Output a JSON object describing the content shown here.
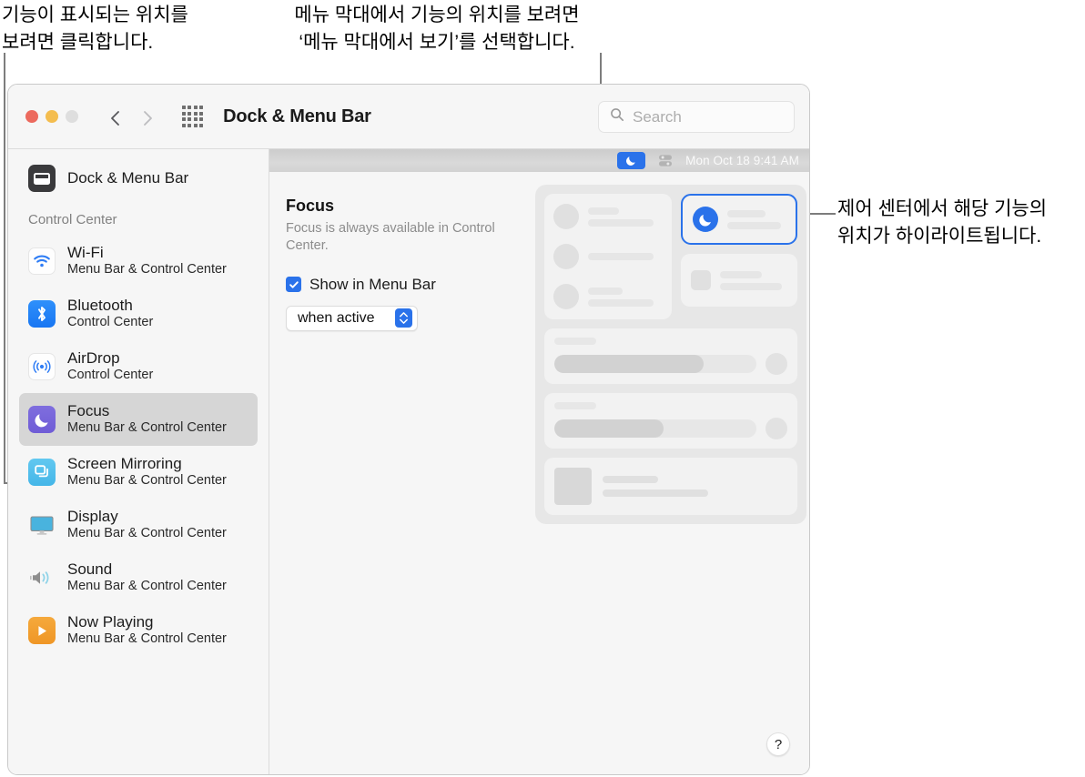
{
  "annotations": {
    "left": "기능이 표시되는 위치를\n보려면 클릭합니다.",
    "top": "메뉴 막대에서 기능의 위치를 보려면\n‘메뉴 막대에서 보기’를 선택합니다.",
    "right": "제어 센터에서 해당 기능의\n위치가 하이라이트됩니다."
  },
  "window": {
    "title": "Dock & Menu Bar",
    "traffic_lights": [
      "close",
      "minimize",
      "zoom"
    ],
    "nav": {
      "back": "back-arrow",
      "forward": "forward-arrow",
      "grid": "show-all-grid"
    },
    "search": {
      "placeholder": "Search",
      "icon": "search-icon"
    }
  },
  "sidebar": {
    "top_item": {
      "label": "Dock & Menu Bar",
      "icon": "dock-icon"
    },
    "group_label": "Control Center",
    "items": [
      {
        "label": "Wi-Fi",
        "sublabel": "Menu Bar & Control Center",
        "icon": "wifi-icon",
        "selected": false
      },
      {
        "label": "Bluetooth",
        "sublabel": "Control Center",
        "icon": "bluetooth-icon",
        "selected": false
      },
      {
        "label": "AirDrop",
        "sublabel": "Control Center",
        "icon": "airdrop-icon",
        "selected": false
      },
      {
        "label": "Focus",
        "sublabel": "Menu Bar & Control Center",
        "icon": "focus-moon-icon",
        "selected": true
      },
      {
        "label": "Screen Mirroring",
        "sublabel": "Menu Bar & Control Center",
        "icon": "screen-mirroring-icon",
        "selected": false
      },
      {
        "label": "Display",
        "sublabel": "Menu Bar & Control Center",
        "icon": "display-icon",
        "selected": false
      },
      {
        "label": "Sound",
        "sublabel": "Menu Bar & Control Center",
        "icon": "sound-icon",
        "selected": false
      },
      {
        "label": "Now Playing",
        "sublabel": "Menu Bar & Control Center",
        "icon": "now-playing-icon",
        "selected": false
      }
    ]
  },
  "menubar_preview": {
    "focus_icon": "focus-moon-icon",
    "control_center_icon": "control-center-icon",
    "clock": "Mon Oct 18  9:41 AM"
  },
  "detail": {
    "title": "Focus",
    "subtitle": "Focus is always available in Control Center.",
    "checkbox": {
      "label": "Show in Menu Bar",
      "checked": true
    },
    "popup": {
      "value": "when active",
      "icon": "updown-chevrons-icon"
    }
  },
  "control_center_preview": {
    "focus_tile_icon": "focus-moon-icon",
    "focus_tile_highlighted": true
  },
  "help": {
    "label": "?"
  },
  "colors": {
    "accent_blue": "#2a72ea",
    "focus_purple": "#7f6ede",
    "bluetooth_blue": "#2f90fb",
    "screen_mirroring_cyan": "#62c8f0",
    "now_playing_orange": "#f5a93c",
    "selected_row": "#d6d6d6",
    "sidebar_bg": "#f6f6f6",
    "menubar_gray": "#d4d4d4"
  }
}
